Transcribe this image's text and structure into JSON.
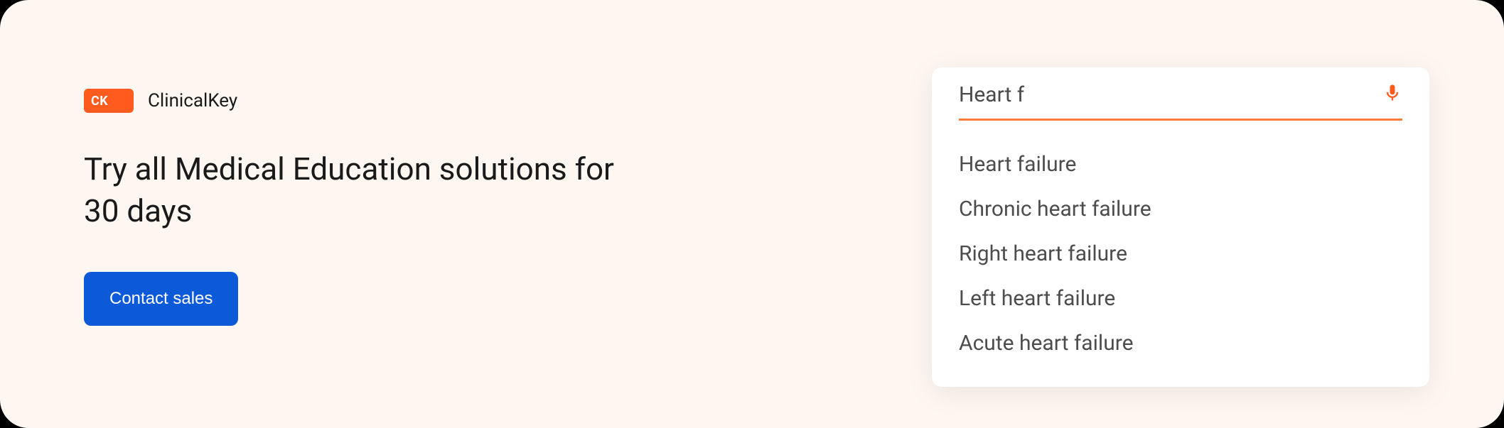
{
  "brand": {
    "badge_text": "CK",
    "name": "ClinicalKey",
    "accent_color": "#ff5b1f"
  },
  "headline": "Try all Medical Education solutions for 30 days",
  "cta": {
    "label": "Contact sales",
    "color": "#0d5ad8"
  },
  "search": {
    "value": "Heart f",
    "suggestions": [
      "Heart failure",
      "Chronic heart failure",
      "Right heart failure",
      "Left heart failure",
      "Acute heart failure"
    ]
  }
}
